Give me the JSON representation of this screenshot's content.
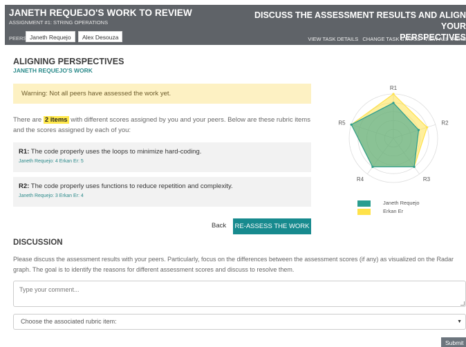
{
  "header": {
    "title": "JANETH REQUEJO'S WORK TO REVIEW",
    "assignment": "ASSIGNMENT #1: STRING OPERATIONS",
    "peers_label": "PEERS:",
    "peers": [
      "Janeth Requejo",
      "Alex Desouza"
    ],
    "task_title_line1": "DISCUSS THE ASSESSMENT RESULTS AND ALIGN YOUR",
    "task_title_line2": "PERSPECTIVES",
    "links": [
      "VIEW TASK DETAILS",
      "CHANGE TASK STATUS",
      "VIEW ALL TASKS"
    ]
  },
  "section": {
    "title": "ALIGNING PERSPECTIVES",
    "subtitle": "JANETH REQUEJO'S WORK",
    "warning": "Warning: Not all peers have assessed the work yet.",
    "intro_before": "There are ",
    "intro_highlight": "2 items",
    "intro_after": " with different scores assigned by you and your peers. Below are these rubric items and the scores assigned by each of you:"
  },
  "rubrics": [
    {
      "code": "R1:",
      "text": " The code properly uses the loops to minimize hard-coding.",
      "scores": "Janeth Requejo: 4  Erkan Er: 5"
    },
    {
      "code": "R2:",
      "text": " The code properly uses functions to reduce repetition and complexity.",
      "scores": "Janeth Requejo: 3  Erkan Er: 4"
    }
  ],
  "buttons": {
    "back": "Back",
    "reassess": "RE-ASSESS THE WORK",
    "submit": "Submit"
  },
  "chart_data": {
    "type": "radar",
    "axes": [
      "R1",
      "R2",
      "R3",
      "R4",
      "R5"
    ],
    "rmax": 5,
    "rings": 5,
    "series": [
      {
        "name": "Erkan Er",
        "color": "#ffe24a",
        "values": [
          5,
          4,
          4,
          4,
          5
        ]
      },
      {
        "name": "Janeth Requejo",
        "color": "#2a9d8f",
        "values": [
          4,
          3,
          4,
          4,
          5
        ]
      }
    ],
    "legend": [
      {
        "name": "Janeth Requejo",
        "color": "#2a9d8f"
      },
      {
        "name": "Erkan Er",
        "color": "#ffe24a"
      }
    ]
  },
  "discussion": {
    "title": "DISCUSSION",
    "text": "Please discuss the assessment results with your peers. Particularly, focus on the differences between the assessment scores (if any) as visualized on the Radar graph. The goal is to identify the reasons for different assessment scores and discuss to resolve them.",
    "comment_placeholder": "Type your comment...",
    "select_label": "Choose the associated rubric item:"
  }
}
